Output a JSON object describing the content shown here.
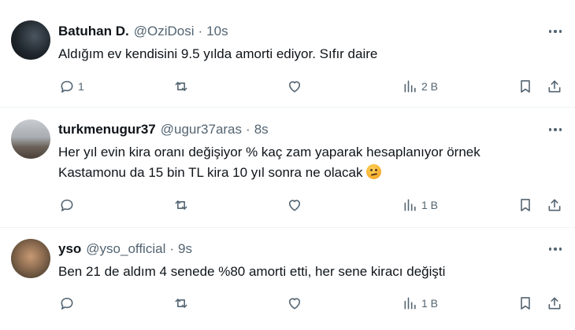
{
  "tweets": [
    {
      "name": "Batuhan D.",
      "handle": "@OziDosi",
      "separator": "·",
      "time": "10s",
      "text": "Aldığım ev kendisini 9.5 yılda amorti ediyor.  Sıfır daire",
      "text_line2": "",
      "replies": "1",
      "views": "2 B"
    },
    {
      "name": "turkmenugur37",
      "handle": "@ugur37aras",
      "separator": "·",
      "time": "8s",
      "text": "Her yıl evin kira oranı değişiyor % kaç zam yaparak hesaplanıyor örnek",
      "text_line2": "Kastamonu da 15 bin TL kira 10 yıl sonra ne olacak",
      "replies": "",
      "views": "1 B"
    },
    {
      "name": "yso",
      "handle": "@yso_official",
      "separator": "·",
      "time": "9s",
      "text": "Ben 21 de aldım 4 senede %80 amorti etti, her sene kiracı değişti",
      "text_line2": "",
      "replies": "",
      "views": "1 B"
    }
  ],
  "icons": {
    "reply": "reply-icon",
    "retweet": "retweet-icon",
    "like": "like-icon",
    "views": "views-icon",
    "bookmark": "bookmark-icon",
    "share": "share-icon",
    "more": "more-icon",
    "emoji": "thinking-face-emoji"
  },
  "colors": {
    "text": "#0f1419",
    "secondary": "#536471",
    "divider": "#eff3f4",
    "background": "#ffffff"
  }
}
